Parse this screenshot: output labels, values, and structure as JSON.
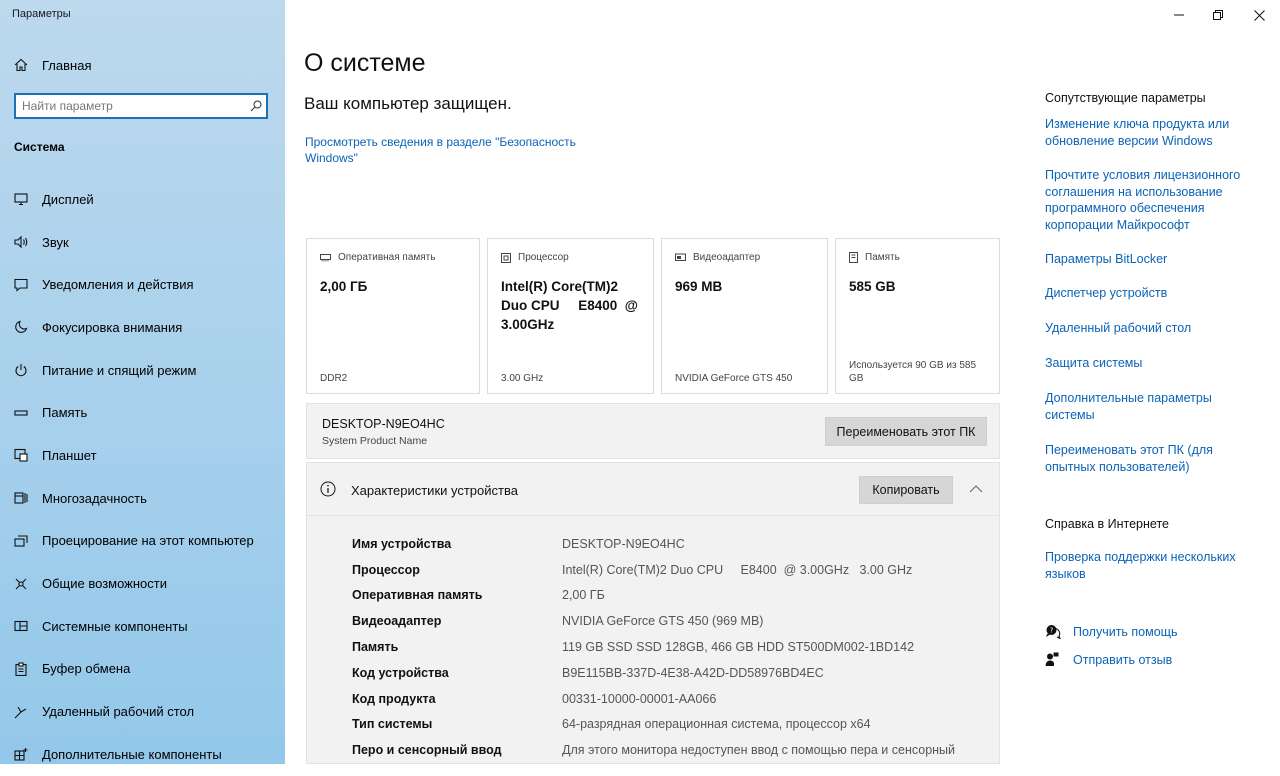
{
  "app": {
    "title": "Параметры"
  },
  "sidebar": {
    "home_label": "Главная",
    "search_placeholder": "Найти параметр",
    "section_title": "Система",
    "items": [
      {
        "label": "Дисплей",
        "icon": "monitor-icon"
      },
      {
        "label": "Звук",
        "icon": "speaker-icon"
      },
      {
        "label": "Уведомления и действия",
        "icon": "notification-icon"
      },
      {
        "label": "Фокусировка внимания",
        "icon": "moon-icon"
      },
      {
        "label": "Питание и спящий режим",
        "icon": "power-icon"
      },
      {
        "label": "Память",
        "icon": "storage-icon"
      },
      {
        "label": "Планшет",
        "icon": "tablet-icon"
      },
      {
        "label": "Многозадачность",
        "icon": "multitasking-icon"
      },
      {
        "label": "Проецирование на этот компьютер",
        "icon": "projection-icon"
      },
      {
        "label": "Общие возможности",
        "icon": "shared-experiences-icon"
      },
      {
        "label": "Системные компоненты",
        "icon": "components-icon"
      },
      {
        "label": "Буфер обмена",
        "icon": "clipboard-icon"
      },
      {
        "label": "Удаленный рабочий стол",
        "icon": "remote-desktop-icon"
      },
      {
        "label": "Дополнительные компоненты",
        "icon": "optional-features-icon"
      }
    ]
  },
  "main": {
    "title": "О системе",
    "protected_text": "Ваш компьютер защищен.",
    "security_link": "Просмотреть сведения в разделе \"Безопасность Windows\"",
    "cards": [
      {
        "label": "Оперативная память",
        "icon": "ram-icon",
        "value": "2,00 ГБ",
        "sub": "DDR2"
      },
      {
        "label": "Процессор",
        "icon": "cpu-icon",
        "value": "Intel(R) Core(TM)2 Duo CPU     E8400  @ 3.00GHz",
        "sub": "3.00 GHz"
      },
      {
        "label": "Видеоадаптер",
        "icon": "gpu-icon",
        "value": "969 MB",
        "sub": "NVIDIA GeForce GTS 450"
      },
      {
        "label": "Память",
        "icon": "disk-icon",
        "value": "585 GB",
        "sub": "Используется 90 GB из 585 GB"
      }
    ],
    "pc_name": "DESKTOP-N9EO4HC",
    "pc_sub": "System Product Name",
    "rename_button": "Переименовать этот ПК",
    "specs_header": "Характеристики устройства",
    "copy_button": "Копировать",
    "specs": [
      {
        "key": "Имя устройства",
        "value": "DESKTOP-N9EO4HC"
      },
      {
        "key": "Процессор",
        "value": "Intel(R) Core(TM)2 Duo CPU     E8400  @ 3.00GHz   3.00 GHz"
      },
      {
        "key": "Оперативная память",
        "value": "2,00 ГБ"
      },
      {
        "key": "Видеоадаптер",
        "value": "NVIDIA GeForce GTS 450 (969 MB)"
      },
      {
        "key": "Память",
        "value": "119 GB SSD SSD 128GB, 466 GB HDD ST500DM002-1BD142"
      },
      {
        "key": "Код устройства",
        "value": "B9E115BB-337D-4E38-A42D-DD58976BD4EC"
      },
      {
        "key": "Код продукта",
        "value": "00331-10000-00001-AA066"
      },
      {
        "key": "Тип системы",
        "value": "64-разрядная операционная система, процессор x64"
      },
      {
        "key": "Перо и сенсорный ввод",
        "value": "Для этого монитора недоступен ввод с помощью пера и сенсорный"
      }
    ]
  },
  "right": {
    "related_title": "Сопутствующие параметры",
    "links": [
      "Изменение ключа продукта или обновление версии Windows",
      "Прочтите условия лицензионного соглашения на использование программного обеспечения корпорации Майкрософт",
      "Параметры BitLocker",
      "Диспетчер устройств",
      "Удаленный рабочий стол",
      "Защита системы",
      "Дополнительные параметры системы",
      "Переименовать этот ПК (для опытных пользователей)"
    ],
    "web_help_title": "Справка в Интернете",
    "web_help_link": "Проверка поддержки нескольких языков",
    "get_help": "Получить помощь",
    "feedback": "Отправить отзыв"
  },
  "colors": {
    "accent": "#0b63b6",
    "sidebar_top": "#bcd9ee",
    "sidebar_bottom": "#93c8ea"
  }
}
